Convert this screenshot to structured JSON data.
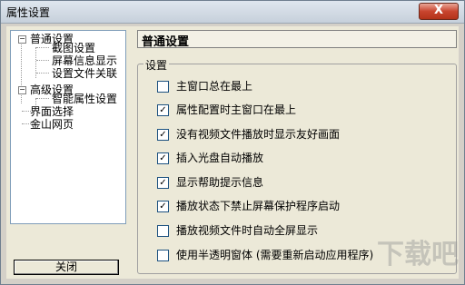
{
  "window": {
    "title": "属性设置",
    "close_glyph": "X"
  },
  "tree": {
    "items": [
      {
        "label": "普通设置",
        "expander": "−",
        "level": 0
      },
      {
        "label": "截图设置",
        "level": 1
      },
      {
        "label": "屏幕信息显示",
        "level": 1
      },
      {
        "label": "设置文件关联",
        "level": 1
      },
      {
        "label": "高级设置",
        "expander": "−",
        "level": 0
      },
      {
        "label": "智能属性设置",
        "level": 1
      },
      {
        "label": "界面选择",
        "level": 0
      },
      {
        "label": "金山网页",
        "level": 0
      }
    ]
  },
  "close_button": {
    "label": "关闭"
  },
  "page": {
    "title": "普通设置",
    "group_label": "设置",
    "options": [
      {
        "label": "主窗口总在最上",
        "checked": false
      },
      {
        "label": "属性配置时主窗口在最上",
        "checked": true
      },
      {
        "label": "没有视频文件播放时显示友好画面",
        "checked": true
      },
      {
        "label": "插入光盘自动播放",
        "checked": true
      },
      {
        "label": "显示帮助提示信息",
        "checked": true
      },
      {
        "label": "播放状态下禁止屏幕保护程序启动",
        "checked": true
      },
      {
        "label": "播放视频文件时自动全屏显示",
        "checked": false
      },
      {
        "label": "使用半透明窗体 (需要重新启动应用程序)",
        "checked": false
      }
    ]
  },
  "watermark": {
    "text": "下载吧"
  },
  "check_mark": "✓"
}
